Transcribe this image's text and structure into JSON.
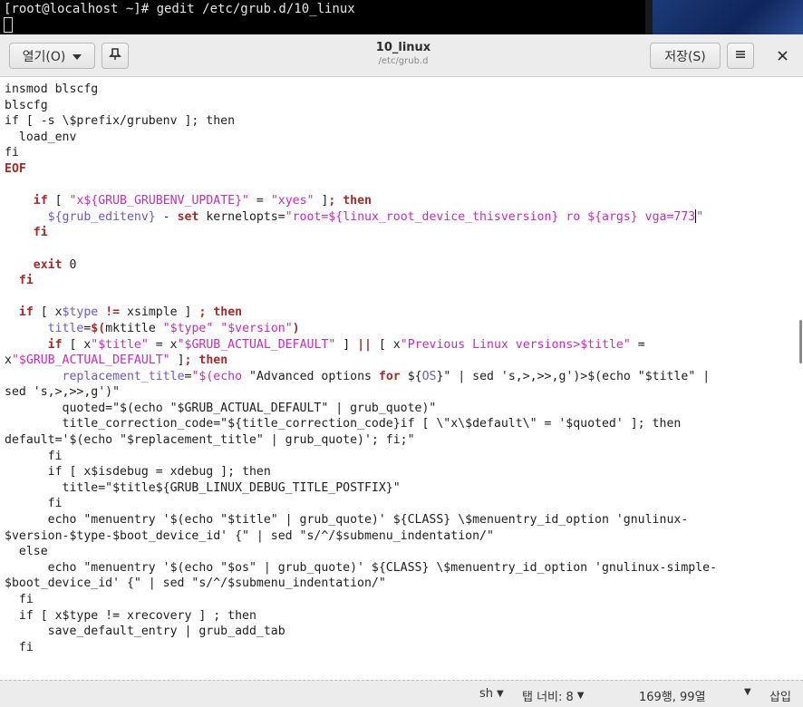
{
  "terminal": {
    "prompt_line": "[root@localhost ~]# gedit /etc/grub.d/10_linux"
  },
  "headerbar": {
    "open_label": "열기(O)",
    "title": "10_linux",
    "subtitle": "/etc/grub.d",
    "save_label": "저장(S)"
  },
  "icons": {
    "open_dropdown": "chevron-down-icon",
    "pin": "new-document-icon",
    "menu": "hamburger-icon",
    "close": "close-icon"
  },
  "editor": {
    "lines": [
      [
        {
          "t": "insmod blscfg"
        }
      ],
      [
        {
          "t": "blscfg"
        }
      ],
      [
        {
          "t": "if [ -s \\$prefix/grubenv ]; then"
        }
      ],
      [
        {
          "t": "  load_env"
        }
      ],
      [
        {
          "t": "fi"
        }
      ],
      [
        {
          "t": "EOF",
          "c": "kw"
        }
      ],
      [
        {
          "t": ""
        }
      ],
      [
        {
          "t": "    "
        },
        {
          "t": "if",
          "c": "kw"
        },
        {
          "t": " [ "
        },
        {
          "t": "\"x${GRUB_GRUBENV_UPDATE}\"",
          "c": "str"
        },
        {
          "t": " = "
        },
        {
          "t": "\"xyes\"",
          "c": "str"
        },
        {
          "t": " ]"
        },
        {
          "t": "; then",
          "c": "kw"
        }
      ],
      [
        {
          "t": "      "
        },
        {
          "t": "${grub_editenv}",
          "c": "var"
        },
        {
          "t": " - "
        },
        {
          "t": "set",
          "c": "kw"
        },
        {
          "t": " kernelopts="
        },
        {
          "t": "\"root=${linux_root_device_thisversion} ro ${args} vga=773",
          "c": "str"
        },
        {
          "caret": true
        },
        {
          "t": "\"",
          "c": "str"
        }
      ],
      [
        {
          "t": "    "
        },
        {
          "t": "fi",
          "c": "kw"
        }
      ],
      [
        {
          "t": ""
        }
      ],
      [
        {
          "t": "    "
        },
        {
          "t": "exit",
          "c": "kw"
        },
        {
          "t": " 0"
        }
      ],
      [
        {
          "t": "  "
        },
        {
          "t": "fi",
          "c": "kw"
        }
      ],
      [
        {
          "t": ""
        }
      ],
      [
        {
          "t": "  "
        },
        {
          "t": "if",
          "c": "kw"
        },
        {
          "t": " [ x"
        },
        {
          "t": "$type",
          "c": "var"
        },
        {
          "t": " "
        },
        {
          "t": "!=",
          "c": "kw"
        },
        {
          "t": " xsimple ] "
        },
        {
          "t": "; then",
          "c": "kw"
        }
      ],
      [
        {
          "t": "      "
        },
        {
          "t": "title",
          "c": "var"
        },
        {
          "t": "="
        },
        {
          "t": "$(",
          "c": "kw"
        },
        {
          "t": "mktitle "
        },
        {
          "t": "\"$type\"",
          "c": "str"
        },
        {
          "t": " "
        },
        {
          "t": "\"$version\"",
          "c": "str"
        },
        {
          "t": ")",
          "c": "kw"
        }
      ],
      [
        {
          "t": "      "
        },
        {
          "t": "if",
          "c": "kw"
        },
        {
          "t": " [ x"
        },
        {
          "t": "\"$title\"",
          "c": "str"
        },
        {
          "t": " = x"
        },
        {
          "t": "\"$GRUB_ACTUAL_DEFAULT\"",
          "c": "str"
        },
        {
          "t": " ] "
        },
        {
          "t": "||",
          "c": "kw"
        },
        {
          "t": " [ x"
        },
        {
          "t": "\"Previous Linux versions>$title\"",
          "c": "str"
        },
        {
          "t": " ="
        }
      ],
      [
        {
          "t": "x"
        },
        {
          "t": "\"$GRUB_ACTUAL_DEFAULT\"",
          "c": "str"
        },
        {
          "t": " ]"
        },
        {
          "t": "; then",
          "c": "kw"
        }
      ],
      [
        {
          "t": "        "
        },
        {
          "t": "replacement_title",
          "c": "var"
        },
        {
          "t": "="
        },
        {
          "t": "\"$(echo ",
          "c": "str"
        },
        {
          "t": "\"Advanced options "
        },
        {
          "t": "for",
          "c": "kw"
        },
        {
          "t": " ${"
        },
        {
          "t": "OS",
          "c": "var"
        },
        {
          "t": "}\" | sed 's,>,>>,g')>$(echo \"$title\" |"
        }
      ],
      [
        {
          "t": "sed 's,>,>>,g')\""
        }
      ],
      [
        {
          "t": "        quoted=\"$(echo \"$GRUB_ACTUAL_DEFAULT\" | grub_quote)\""
        }
      ],
      [
        {
          "t": "        title_correction_code=\"${title_correction_code}if [ \\\"x\\$default\\\" = '$quoted' ]; then"
        }
      ],
      [
        {
          "t": "default='$(echo \"$replacement_title\" | grub_quote)'; fi;\""
        }
      ],
      [
        {
          "t": "      fi"
        }
      ],
      [
        {
          "t": "      if [ x$isdebug = xdebug ]; then"
        }
      ],
      [
        {
          "t": "        title=\"$title${GRUB_LINUX_DEBUG_TITLE_POSTFIX}\""
        }
      ],
      [
        {
          "t": "      fi"
        }
      ],
      [
        {
          "t": "      echo \"menuentry '$(echo \"$title\" | grub_quote)' ${CLASS} \\$menuentry_id_option 'gnulinux-"
        }
      ],
      [
        {
          "t": "$version-$type-$boot_device_id' {\" | sed \"s/^/$submenu_indentation/\""
        }
      ],
      [
        {
          "t": "  else"
        }
      ],
      [
        {
          "t": "      echo \"menuentry '$(echo \"$os\" | grub_quote)' ${CLASS} \\$menuentry_id_option 'gnulinux-simple-"
        }
      ],
      [
        {
          "t": "$boot_device_id' {\" | sed \"s/^/$submenu_indentation/\""
        }
      ],
      [
        {
          "t": "  fi"
        }
      ],
      [
        {
          "t": "  if [ x$type != xrecovery ] ; then"
        }
      ],
      [
        {
          "t": "      save_default_entry | grub_add_tab"
        }
      ],
      [
        {
          "t": "  fi"
        }
      ]
    ]
  },
  "statusbar": {
    "language": "sh",
    "tab_width": "탭 너비: 8",
    "position": "169행, 99열",
    "mode": "삽입"
  }
}
